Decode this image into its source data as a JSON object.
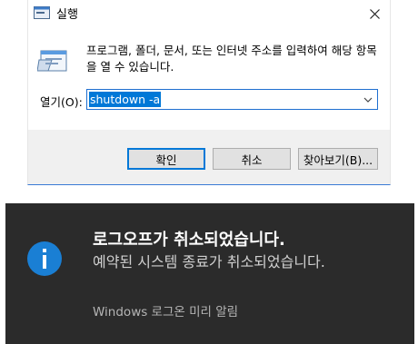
{
  "dialog": {
    "title": "실행",
    "description": "프로그램, 폴더, 문서, 또는 인터넷 주소를 입력하여 해당 항목을 열 수 있습니다.",
    "open_label": "열기(O):",
    "open_value": "shutdown -a",
    "ok_label": "확인",
    "cancel_label": "취소",
    "browse_label": "찾아보기(B)..."
  },
  "notification": {
    "title": "로그오프가 취소되었습니다.",
    "body": "예약된 시스템 종료가 취소되었습니다.",
    "source": "Windows 로그온 미리 알림"
  },
  "icons": {
    "title": "run-icon",
    "close": "close-icon",
    "program": "run-program-icon",
    "dropdown": "chevron-down-icon",
    "info": "info-icon"
  },
  "colors": {
    "accent": "#0078d7",
    "selection": "#0078d7",
    "notification_bg": "#2b2b2b",
    "info_icon": "#1a7fd4"
  }
}
